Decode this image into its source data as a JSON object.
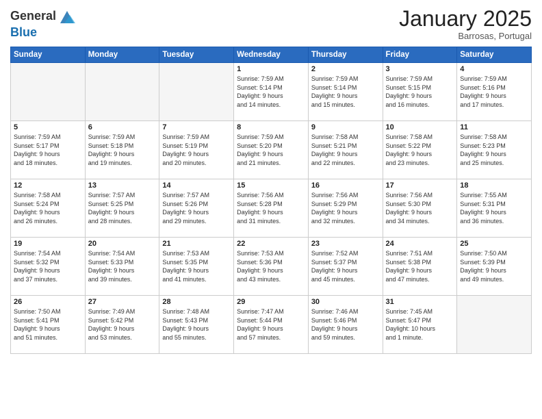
{
  "header": {
    "logo_general": "General",
    "logo_blue": "Blue",
    "month": "January 2025",
    "location": "Barrosas, Portugal"
  },
  "days_of_week": [
    "Sunday",
    "Monday",
    "Tuesday",
    "Wednesday",
    "Thursday",
    "Friday",
    "Saturday"
  ],
  "weeks": [
    [
      {
        "day": "",
        "info": ""
      },
      {
        "day": "",
        "info": ""
      },
      {
        "day": "",
        "info": ""
      },
      {
        "day": "1",
        "info": "Sunrise: 7:59 AM\nSunset: 5:14 PM\nDaylight: 9 hours\nand 14 minutes."
      },
      {
        "day": "2",
        "info": "Sunrise: 7:59 AM\nSunset: 5:14 PM\nDaylight: 9 hours\nand 15 minutes."
      },
      {
        "day": "3",
        "info": "Sunrise: 7:59 AM\nSunset: 5:15 PM\nDaylight: 9 hours\nand 16 minutes."
      },
      {
        "day": "4",
        "info": "Sunrise: 7:59 AM\nSunset: 5:16 PM\nDaylight: 9 hours\nand 17 minutes."
      }
    ],
    [
      {
        "day": "5",
        "info": "Sunrise: 7:59 AM\nSunset: 5:17 PM\nDaylight: 9 hours\nand 18 minutes."
      },
      {
        "day": "6",
        "info": "Sunrise: 7:59 AM\nSunset: 5:18 PM\nDaylight: 9 hours\nand 19 minutes."
      },
      {
        "day": "7",
        "info": "Sunrise: 7:59 AM\nSunset: 5:19 PM\nDaylight: 9 hours\nand 20 minutes."
      },
      {
        "day": "8",
        "info": "Sunrise: 7:59 AM\nSunset: 5:20 PM\nDaylight: 9 hours\nand 21 minutes."
      },
      {
        "day": "9",
        "info": "Sunrise: 7:58 AM\nSunset: 5:21 PM\nDaylight: 9 hours\nand 22 minutes."
      },
      {
        "day": "10",
        "info": "Sunrise: 7:58 AM\nSunset: 5:22 PM\nDaylight: 9 hours\nand 23 minutes."
      },
      {
        "day": "11",
        "info": "Sunrise: 7:58 AM\nSunset: 5:23 PM\nDaylight: 9 hours\nand 25 minutes."
      }
    ],
    [
      {
        "day": "12",
        "info": "Sunrise: 7:58 AM\nSunset: 5:24 PM\nDaylight: 9 hours\nand 26 minutes."
      },
      {
        "day": "13",
        "info": "Sunrise: 7:57 AM\nSunset: 5:25 PM\nDaylight: 9 hours\nand 28 minutes."
      },
      {
        "day": "14",
        "info": "Sunrise: 7:57 AM\nSunset: 5:26 PM\nDaylight: 9 hours\nand 29 minutes."
      },
      {
        "day": "15",
        "info": "Sunrise: 7:56 AM\nSunset: 5:28 PM\nDaylight: 9 hours\nand 31 minutes."
      },
      {
        "day": "16",
        "info": "Sunrise: 7:56 AM\nSunset: 5:29 PM\nDaylight: 9 hours\nand 32 minutes."
      },
      {
        "day": "17",
        "info": "Sunrise: 7:56 AM\nSunset: 5:30 PM\nDaylight: 9 hours\nand 34 minutes."
      },
      {
        "day": "18",
        "info": "Sunrise: 7:55 AM\nSunset: 5:31 PM\nDaylight: 9 hours\nand 36 minutes."
      }
    ],
    [
      {
        "day": "19",
        "info": "Sunrise: 7:54 AM\nSunset: 5:32 PM\nDaylight: 9 hours\nand 37 minutes."
      },
      {
        "day": "20",
        "info": "Sunrise: 7:54 AM\nSunset: 5:33 PM\nDaylight: 9 hours\nand 39 minutes."
      },
      {
        "day": "21",
        "info": "Sunrise: 7:53 AM\nSunset: 5:35 PM\nDaylight: 9 hours\nand 41 minutes."
      },
      {
        "day": "22",
        "info": "Sunrise: 7:53 AM\nSunset: 5:36 PM\nDaylight: 9 hours\nand 43 minutes."
      },
      {
        "day": "23",
        "info": "Sunrise: 7:52 AM\nSunset: 5:37 PM\nDaylight: 9 hours\nand 45 minutes."
      },
      {
        "day": "24",
        "info": "Sunrise: 7:51 AM\nSunset: 5:38 PM\nDaylight: 9 hours\nand 47 minutes."
      },
      {
        "day": "25",
        "info": "Sunrise: 7:50 AM\nSunset: 5:39 PM\nDaylight: 9 hours\nand 49 minutes."
      }
    ],
    [
      {
        "day": "26",
        "info": "Sunrise: 7:50 AM\nSunset: 5:41 PM\nDaylight: 9 hours\nand 51 minutes."
      },
      {
        "day": "27",
        "info": "Sunrise: 7:49 AM\nSunset: 5:42 PM\nDaylight: 9 hours\nand 53 minutes."
      },
      {
        "day": "28",
        "info": "Sunrise: 7:48 AM\nSunset: 5:43 PM\nDaylight: 9 hours\nand 55 minutes."
      },
      {
        "day": "29",
        "info": "Sunrise: 7:47 AM\nSunset: 5:44 PM\nDaylight: 9 hours\nand 57 minutes."
      },
      {
        "day": "30",
        "info": "Sunrise: 7:46 AM\nSunset: 5:46 PM\nDaylight: 9 hours\nand 59 minutes."
      },
      {
        "day": "31",
        "info": "Sunrise: 7:45 AM\nSunset: 5:47 PM\nDaylight: 10 hours\nand 1 minute."
      },
      {
        "day": "",
        "info": ""
      }
    ]
  ]
}
